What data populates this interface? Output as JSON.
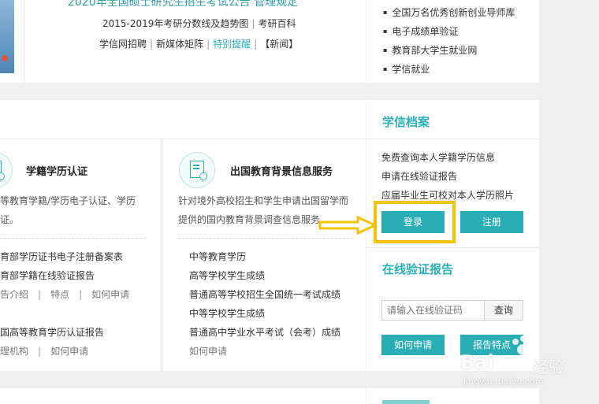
{
  "top": {
    "headline": "2020年全国硕士研究生招生考试公告 管理规定",
    "line1": [
      "2015-2019年考研分数线及趋势图",
      "考研百科"
    ],
    "line2_links": [
      "学信网招聘",
      "新媒体矩阵",
      "特别提醒"
    ],
    "line2_news": "【新闻】",
    "right_list": [
      "全国万名优秀创新创业导师库",
      "电子成绩单验证",
      "教育部大学生就业网",
      "学信就业"
    ]
  },
  "cert": {
    "title": "学籍学历认证",
    "desc": [
      "等教育学籍/学历电子认证、学历",
      "证。"
    ],
    "links": [
      "育部学历证书电子注册备案表",
      "育部学籍在线验证报告"
    ],
    "sub_links1": [
      "告介绍",
      "特点",
      "如何申请"
    ],
    "link3": "国高等教育学历认证报告",
    "sub_links2": [
      "理机构",
      "如何申请"
    ]
  },
  "abroad": {
    "title": "出国教育背景信息服务",
    "desc": [
      "针对境外高校招生和学生申请出国留学而",
      "提供的国内教育背景调查信息服务。"
    ],
    "links": [
      "中等教育学历",
      "高等学校学生成绩",
      "普通高等学校招生全国统一考试成绩",
      "中等学校学生成绩",
      "普通高中学业水平考试（会考）成绩"
    ],
    "apply": "如何申请"
  },
  "archive": {
    "title": "学信档案",
    "items": [
      "免费查询本人学籍学历信息",
      "申请在线验证报告",
      "应届毕业生可校对本人学历照片"
    ],
    "login": "登录",
    "register": "注册"
  },
  "verify": {
    "title": "在线验证报告",
    "placeholder": "请输入在线验证码",
    "query": "查询",
    "apply": "如何申请",
    "report": "报告特点"
  },
  "watermark": {
    "brand": "Bai",
    "sub": "经验",
    "url": "jingyan.baidu.com"
  },
  "colors": {
    "accent": "#2aaeb6",
    "highlight": "#f3c300"
  }
}
